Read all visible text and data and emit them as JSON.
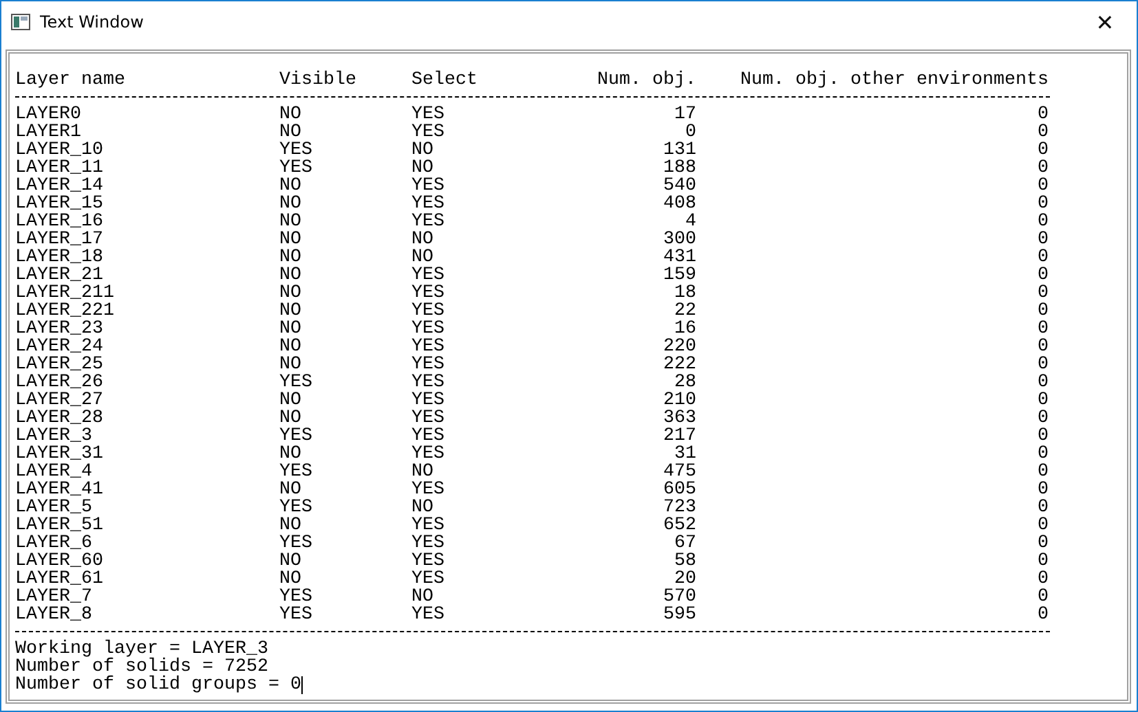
{
  "window": {
    "title": "Text Window",
    "close": "✕"
  },
  "table": {
    "columns": [
      "Layer name",
      "Visible",
      "Select",
      "Num. obj.",
      "Num. obj. other environments"
    ],
    "rows": [
      [
        "LAYER0",
        "NO",
        "YES",
        "17",
        "0"
      ],
      [
        "LAYER1",
        "NO",
        "YES",
        "0",
        "0"
      ],
      [
        "LAYER_10",
        "YES",
        "NO",
        "131",
        "0"
      ],
      [
        "LAYER_11",
        "YES",
        "NO",
        "188",
        "0"
      ],
      [
        "LAYER_14",
        "NO",
        "YES",
        "540",
        "0"
      ],
      [
        "LAYER_15",
        "NO",
        "YES",
        "408",
        "0"
      ],
      [
        "LAYER_16",
        "NO",
        "YES",
        "4",
        "0"
      ],
      [
        "LAYER_17",
        "NO",
        "NO",
        "300",
        "0"
      ],
      [
        "LAYER_18",
        "NO",
        "NO",
        "431",
        "0"
      ],
      [
        "LAYER_21",
        "NO",
        "YES",
        "159",
        "0"
      ],
      [
        "LAYER_211",
        "NO",
        "YES",
        "18",
        "0"
      ],
      [
        "LAYER_221",
        "NO",
        "YES",
        "22",
        "0"
      ],
      [
        "LAYER_23",
        "NO",
        "YES",
        "16",
        "0"
      ],
      [
        "LAYER_24",
        "NO",
        "YES",
        "220",
        "0"
      ],
      [
        "LAYER_25",
        "NO",
        "YES",
        "222",
        "0"
      ],
      [
        "LAYER_26",
        "YES",
        "YES",
        "28",
        "0"
      ],
      [
        "LAYER_27",
        "NO",
        "YES",
        "210",
        "0"
      ],
      [
        "LAYER_28",
        "NO",
        "YES",
        "363",
        "0"
      ],
      [
        "LAYER_3",
        "YES",
        "YES",
        "217",
        "0"
      ],
      [
        "LAYER_31",
        "NO",
        "YES",
        "31",
        "0"
      ],
      [
        "LAYER_4",
        "YES",
        "NO",
        "475",
        "0"
      ],
      [
        "LAYER_41",
        "NO",
        "YES",
        "605",
        "0"
      ],
      [
        "LAYER_5",
        "YES",
        "NO",
        "723",
        "0"
      ],
      [
        "LAYER_51",
        "NO",
        "YES",
        "652",
        "0"
      ],
      [
        "LAYER_6",
        "YES",
        "YES",
        "67",
        "0"
      ],
      [
        "LAYER_60",
        "NO",
        "YES",
        "58",
        "0"
      ],
      [
        "LAYER_61",
        "NO",
        "YES",
        "20",
        "0"
      ],
      [
        "LAYER_7",
        "YES",
        "NO",
        "570",
        "0"
      ],
      [
        "LAYER_8",
        "YES",
        "YES",
        "595",
        "0"
      ]
    ]
  },
  "summary": [
    "Working layer = LAYER_3",
    "Number of solids = 7252",
    "Number of solid groups = 0"
  ]
}
